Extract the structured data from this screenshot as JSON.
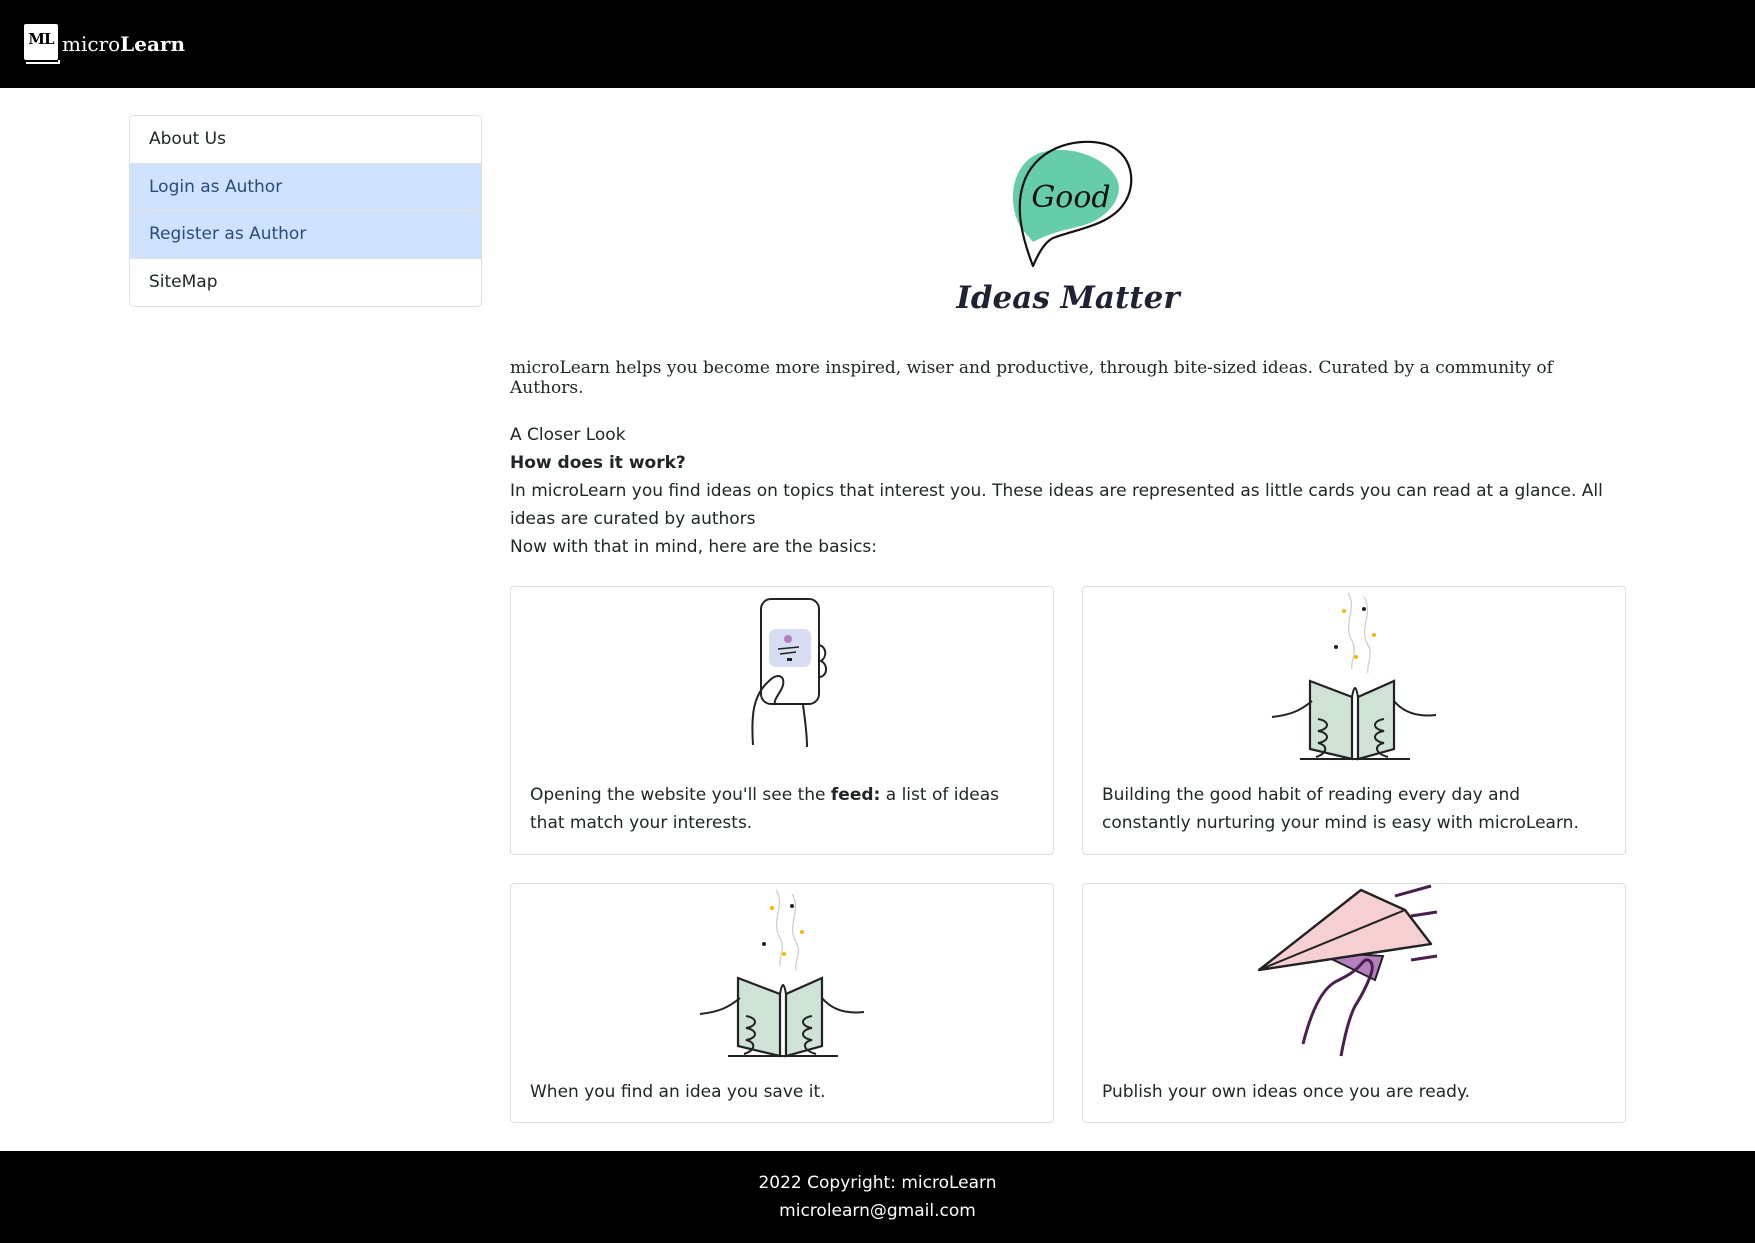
{
  "header": {
    "logo_text": "ML",
    "brand_light": "micro",
    "brand_bold": "Learn"
  },
  "sidebar": {
    "items": [
      {
        "label": "About Us"
      },
      {
        "label": "Login as Author"
      },
      {
        "label": "Register as Author"
      },
      {
        "label": "SiteMap"
      }
    ]
  },
  "hero": {
    "bubble_text": "Good",
    "title": "Ideas Matter"
  },
  "intro": "microLearn helps you become more inspired, wiser and productive, through bite-sized ideas. Curated by a community of Authors.",
  "closer": {
    "kicker": "A Closer Look",
    "heading": "How does it work?",
    "paragraph": "In microLearn you find ideas on topics that interest you. These ideas are represented as little cards you can read at a glance. All ideas are curated by authors",
    "lead": "Now with that in mind, here are the basics:"
  },
  "cards": [
    {
      "caption_pre": "Opening the website you'll see the ",
      "caption_bold": "feed:",
      "caption_post": " a list of ideas that match your interests.",
      "icon": "phone-hand-illustration"
    },
    {
      "caption": "Building the good habit of reading every day and constantly nurturing your mind is easy with microLearn.",
      "icon": "open-book-illustration"
    },
    {
      "caption": "When you find an idea you save it.",
      "icon": "open-book-illustration"
    },
    {
      "caption": "Publish your own ideas once you are ready.",
      "icon": "paper-plane-illustration"
    }
  ],
  "footer": {
    "copyright": "2022 Copyright: microLearn",
    "email": "microlearn@gmail.com"
  },
  "colors": {
    "nav_bg": "#000000",
    "active_item_bg": "#cfe2ff",
    "active_item_text": "#284b80",
    "bubble_green": "#66cdaa",
    "book_green": "#cfe2d6",
    "plane_pink": "#f6cfd3",
    "plane_purple": "#b57fbf"
  }
}
